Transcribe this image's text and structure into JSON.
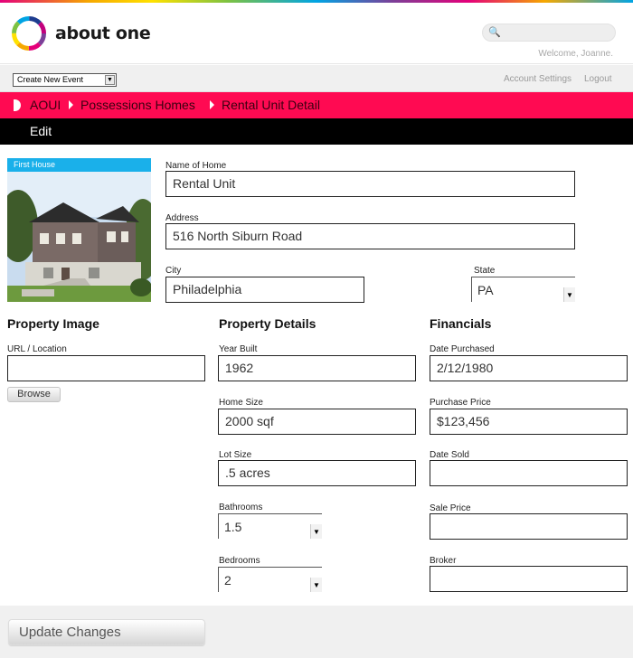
{
  "brand": {
    "name": "about one"
  },
  "header": {
    "search_placeholder": "",
    "welcome": "Welcome, Joanne."
  },
  "subbar": {
    "event_select": "Create New Event",
    "account_settings": "Account Settings",
    "logout": "Logout"
  },
  "breadcrumb": [
    "AOUI",
    "Possessions Homes",
    "Rental Unit Detail"
  ],
  "edit_label": "Edit",
  "photo": {
    "label": "First House"
  },
  "home": {
    "name_label": "Name of Home",
    "name": "Rental Unit",
    "address_label": "Address",
    "address": "516 North Siburn Road",
    "city_label": "City",
    "city": "Philadelphia",
    "state_label": "State",
    "state": "PA"
  },
  "property_image": {
    "title": "Property Image",
    "url_label": "URL / Location",
    "url": "",
    "browse": "Browse"
  },
  "property_details": {
    "title": "Property Details",
    "year_built_label": "Year Built",
    "year_built": "1962",
    "home_size_label": "Home Size",
    "home_size": "2000 sqf",
    "lot_size_label": "Lot Size",
    "lot_size": ".5 acres",
    "bathrooms_label": "Bathrooms",
    "bathrooms": "1.5",
    "bedrooms_label": "Bedrooms",
    "bedrooms": "2"
  },
  "financials": {
    "title": "Financials",
    "date_purchased_label": "Date Purchased",
    "date_purchased": "2/12/1980",
    "purchase_price_label": "Purchase Price",
    "purchase_price": "$123,456",
    "date_sold_label": "Date Sold",
    "date_sold": "",
    "sale_price_label": "Sale Price",
    "sale_price": "",
    "broker_label": "Broker",
    "broker": ""
  },
  "footer": {
    "update_button": "Update Changes"
  },
  "colors": {
    "accent": "#ff0a52",
    "edit_bar": "#000000",
    "photo_label": "#1ab0ea"
  }
}
